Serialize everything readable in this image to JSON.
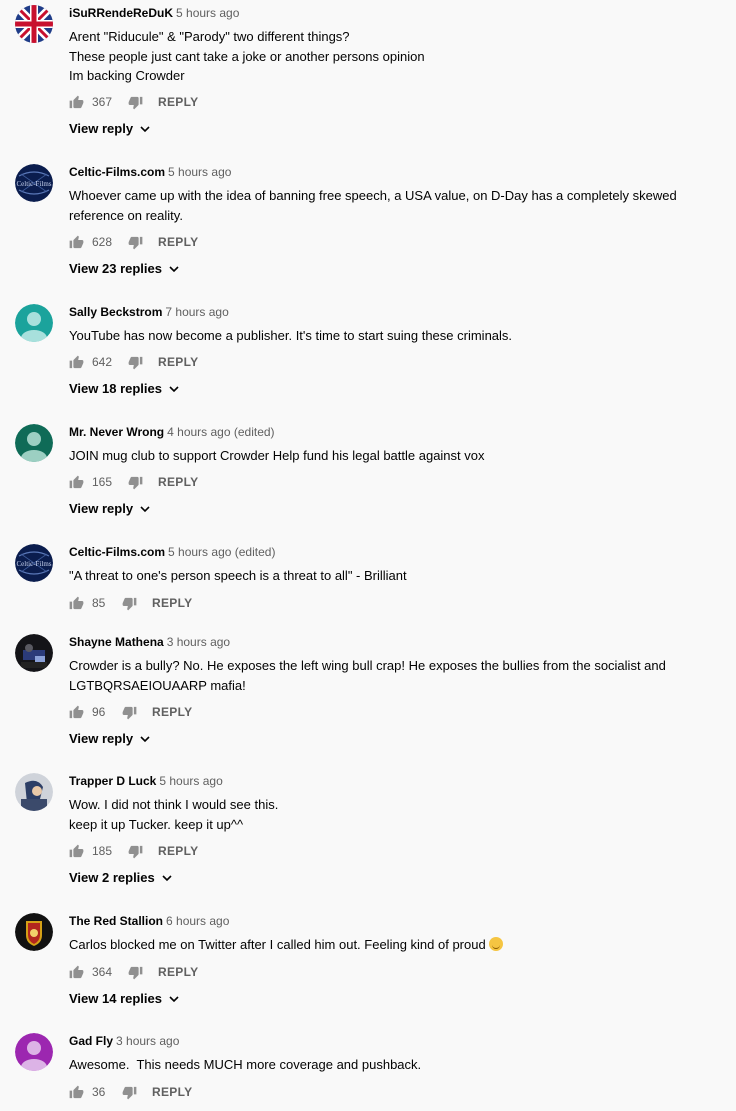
{
  "comments": [
    {
      "author": "iSuRRendeReDuK",
      "time": "5 hours ago",
      "lines": [
        "Arent \"Riducule\" & \"Parody\" two different things?",
        "These people just cant take a joke or another persons opinion",
        "Im backing Crowder"
      ],
      "likes": "367",
      "reply": "REPLY",
      "view": "View reply",
      "avatar": "union-jack-avatar"
    },
    {
      "author": "Celtic-Films.com",
      "time": "5 hours ago",
      "lines": [
        "Whoever came up with the idea of banning free speech, a USA value, on D-Day has a completely skewed",
        "reference on reality."
      ],
      "likes": "628",
      "reply": "REPLY",
      "view": "View 23 replies",
      "avatar": "celtic-films-avatar"
    },
    {
      "author": "Sally Beckstrom",
      "time": "7 hours ago",
      "lines": [
        "YouTube has now become a publisher. It's time to start suing these criminals."
      ],
      "likes": "642",
      "reply": "REPLY",
      "view": "View 18 replies",
      "avatar": "default-teal-avatar"
    },
    {
      "author": "Mr. Never Wrong",
      "time": "4 hours ago (edited)",
      "lines": [
        "JOIN mug club to support Crowder Help fund his legal battle against vox"
      ],
      "likes": "165",
      "reply": "REPLY",
      "view": "View reply",
      "avatar": "default-darkgreen-avatar"
    },
    {
      "author": "Celtic-Films.com",
      "time": "5 hours ago (edited)",
      "lines": [
        "\"A threat to one's person speech is a threat to all\" - Brilliant"
      ],
      "likes": "85",
      "reply": "REPLY",
      "view": "",
      "avatar": "celtic-films-avatar"
    },
    {
      "author": "Shayne Mathena",
      "time": "3 hours ago",
      "lines": [
        "Crowder is a bully? No. He exposes the left wing bull crap! He exposes the bullies from the socialist and",
        "LGTBQRSAEIOUAARP mafia!"
      ],
      "likes": "96",
      "reply": "REPLY",
      "view": "View reply",
      "avatar": "photo-avatar"
    },
    {
      "author": "Trapper D Luck",
      "time": "5 hours ago",
      "lines": [
        "Wow. I did not think I would see this.",
        "keep it up Tucker. keep it up^^"
      ],
      "likes": "185",
      "reply": "REPLY",
      "view": "View 2 replies",
      "avatar": "photo-avatar-2"
    },
    {
      "author": "The Red Stallion",
      "time": "6 hours ago",
      "lines": [
        "Carlos blocked me on Twitter after I called him out. Feeling kind of proud"
      ],
      "emoji": true,
      "likes": "364",
      "reply": "REPLY",
      "view": "View 14 replies",
      "avatar": "stallion-crest-avatar"
    },
    {
      "author": "Gad Fly",
      "time": "3 hours ago",
      "lines": [
        "Awesome.  This needs MUCH more coverage and pushback."
      ],
      "likes": "36",
      "reply": "REPLY",
      "view": "",
      "avatar": "default-purple-avatar"
    }
  ],
  "colors": {
    "teal": "#1ba39c",
    "darkgreen": "#0f6b57",
    "purple": "#9c27b0",
    "navy": "#0b1d4e"
  }
}
